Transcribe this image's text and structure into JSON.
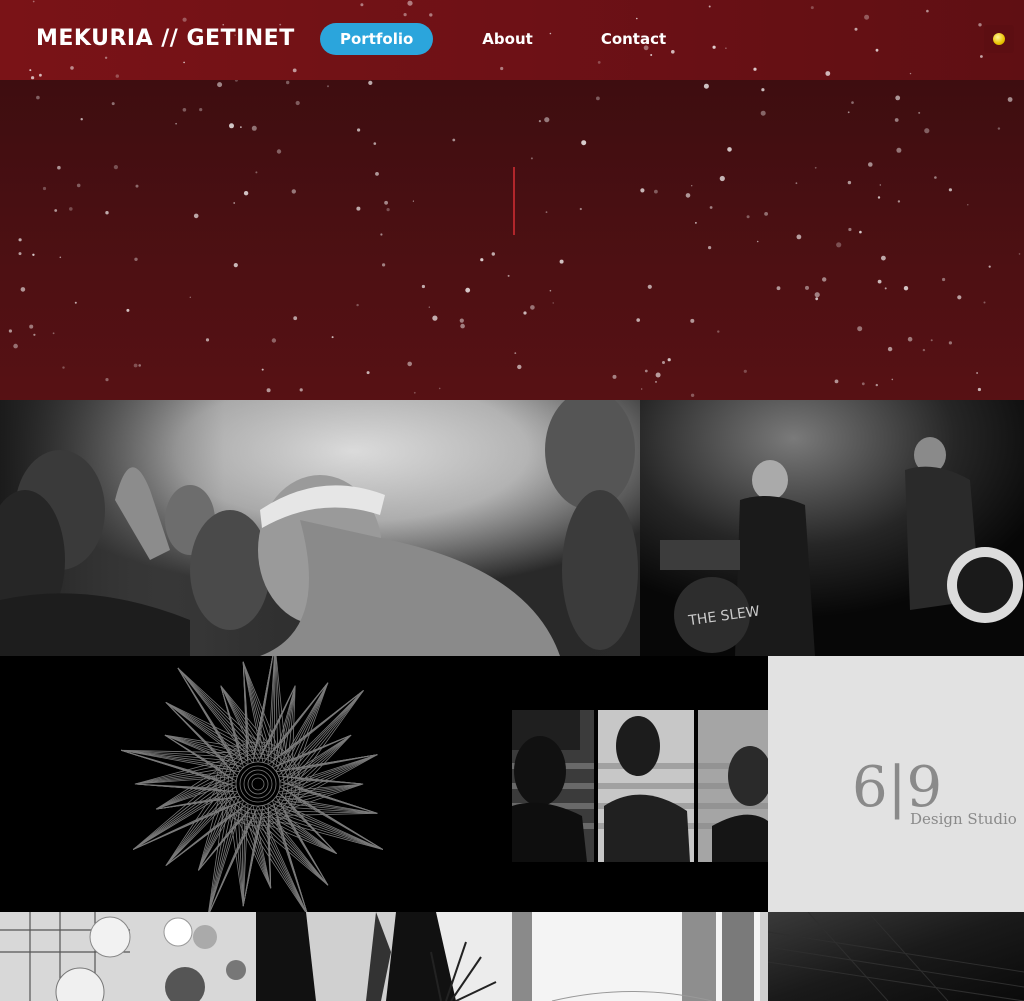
{
  "brand": "MEKURIA // GETINET",
  "nav": {
    "portfolio": "Portfolio",
    "about": "About",
    "contact": "Contact"
  },
  "theme_toggle_icon": "sun-icon",
  "colors": {
    "header": "#6e1116",
    "hero": "#4e1013",
    "active_nav": "#2ba5dc",
    "cursor": "#b2262b"
  },
  "portfolio": {
    "tiles": [
      {
        "name": "crowd-concert-photo"
      },
      {
        "name": "band-stage-photo",
        "drum_text": "THE SLEW"
      },
      {
        "name": "spiral-line-art"
      },
      {
        "name": "flag-portraits-photo"
      },
      {
        "name": "design-studio-logo",
        "logo_numbers": "6|9",
        "logo_text": "Design Studio"
      },
      {
        "name": "architecture-photo"
      },
      {
        "name": "plant-photo"
      },
      {
        "name": "abstract-stripes-photo"
      },
      {
        "name": "dark-texture-photo"
      }
    ]
  }
}
